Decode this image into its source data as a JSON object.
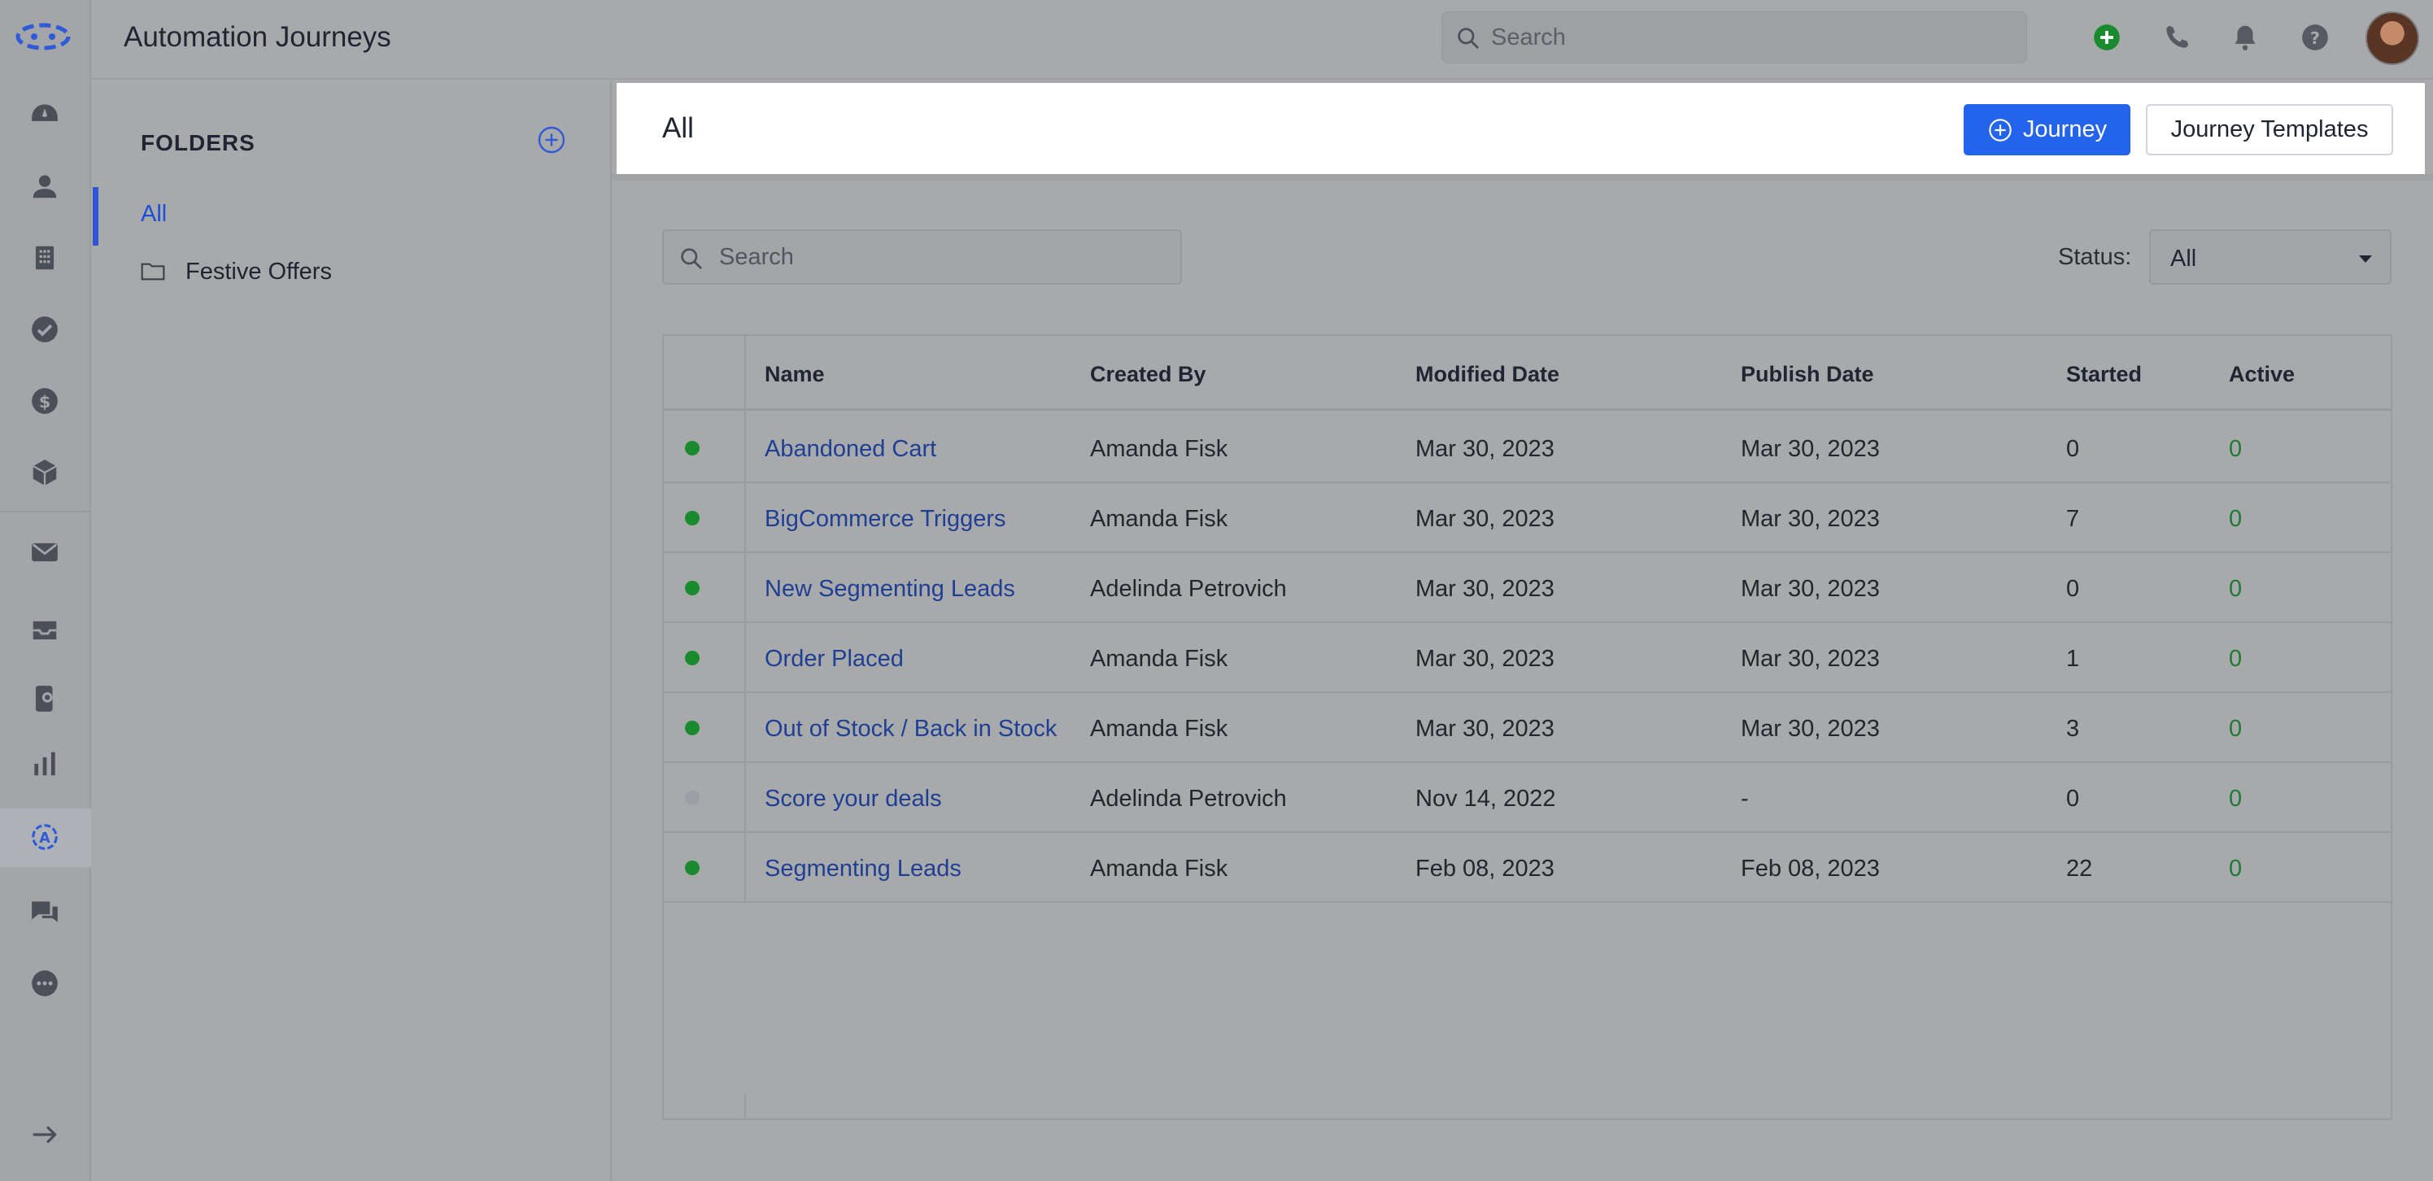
{
  "app": {
    "title": "Automation Journeys"
  },
  "topbar": {
    "search_placeholder": "Search"
  },
  "folders": {
    "title": "FOLDERS",
    "items": [
      {
        "label": "All",
        "active": true
      },
      {
        "label": "Festive Offers",
        "active": false
      }
    ]
  },
  "main": {
    "title": "All",
    "journey_button": "Journey",
    "templates_button": "Journey Templates",
    "search_placeholder": "Search",
    "status_label": "Status:",
    "status_value": "All"
  },
  "table": {
    "columns": [
      "Name",
      "Created By",
      "Modified Date",
      "Publish Date",
      "Started",
      "Active"
    ],
    "rows": [
      {
        "status": "published",
        "name": "Abandoned Cart",
        "created_by": "Amanda Fisk",
        "modified": "Mar 30, 2023",
        "published": "Mar 30, 2023",
        "started": "0",
        "active": "0"
      },
      {
        "status": "published",
        "name": "BigCommerce Triggers",
        "created_by": "Amanda Fisk",
        "modified": "Mar 30, 2023",
        "published": "Mar 30, 2023",
        "started": "7",
        "active": "0"
      },
      {
        "status": "published",
        "name": "New Segmenting Leads",
        "created_by": "Adelinda Petrovich",
        "modified": "Mar 30, 2023",
        "published": "Mar 30, 2023",
        "started": "0",
        "active": "0"
      },
      {
        "status": "published",
        "name": "Order Placed",
        "created_by": "Amanda Fisk",
        "modified": "Mar 30, 2023",
        "published": "Mar 30, 2023",
        "started": "1",
        "active": "0"
      },
      {
        "status": "published",
        "name": "Out of Stock / Back in Stock",
        "created_by": "Amanda Fisk",
        "modified": "Mar 30, 2023",
        "published": "Mar 30, 2023",
        "started": "3",
        "active": "0"
      },
      {
        "status": "draft",
        "name": "Score your deals",
        "created_by": "Adelinda Petrovich",
        "modified": "Nov 14, 2022",
        "published": "-",
        "started": "0",
        "active": "0"
      },
      {
        "status": "published",
        "name": "Segmenting Leads",
        "created_by": "Amanda Fisk",
        "modified": "Feb 08, 2023",
        "published": "Feb 08, 2023",
        "started": "22",
        "active": "0"
      }
    ]
  },
  "colors": {
    "primary": "#2463eb",
    "published_dot": "#1a8a2f",
    "draft_dot": "#9ca0a6",
    "link": "#1e3f94",
    "active_value": "#1f7a33"
  },
  "icons": {
    "rail": [
      "logo-icon",
      "dashboard-icon",
      "contacts-icon",
      "companies-icon",
      "tasks-icon",
      "deals-icon",
      "products-icon",
      "email-icon",
      "inbox-icon",
      "phone-book-icon",
      "reports-icon",
      "automation-icon",
      "conversations-icon",
      "more-icon",
      "expand-icon"
    ],
    "topbar": [
      "search-icon",
      "add-icon",
      "phone-icon",
      "bell-icon",
      "help-icon"
    ]
  }
}
